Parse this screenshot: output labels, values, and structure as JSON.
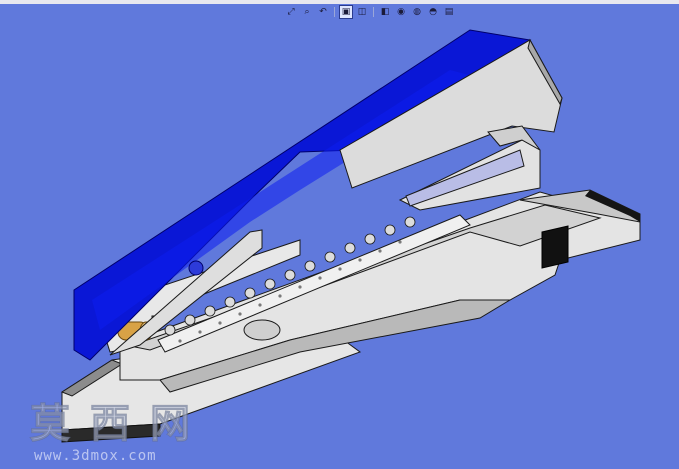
{
  "viewer": {
    "background_color": "#6079dc",
    "toolbar": {
      "tools": [
        {
          "icon": "zoom-fit-icon",
          "glyph": "⤢"
        },
        {
          "icon": "zoom-area-icon",
          "glyph": "⌕"
        },
        {
          "icon": "previous-view-icon",
          "glyph": "↶"
        },
        {
          "icon": "section-view-icon",
          "glyph": "▣",
          "active": true
        },
        {
          "icon": "view-orientation-icon",
          "glyph": "◫"
        },
        {
          "icon": "display-style-icon",
          "glyph": "◧"
        },
        {
          "icon": "hide-show-items-icon",
          "glyph": "◉"
        },
        {
          "icon": "edit-appearance-icon",
          "glyph": "◍"
        },
        {
          "icon": "apply-scene-icon",
          "glyph": "◓"
        },
        {
          "icon": "view-settings-icon",
          "glyph": "▤"
        }
      ]
    }
  },
  "model": {
    "description_colors": {
      "body": "#e4e4e4",
      "body_shade": "#b9b9b9",
      "cover": "#0a17d6",
      "cover_dark": "#00008f",
      "bushing": "#d8a246",
      "slot": "#b9bde6"
    }
  },
  "watermark": {
    "chars": [
      "莫",
      "西",
      "网"
    ],
    "url": "www.3dmox.com"
  }
}
